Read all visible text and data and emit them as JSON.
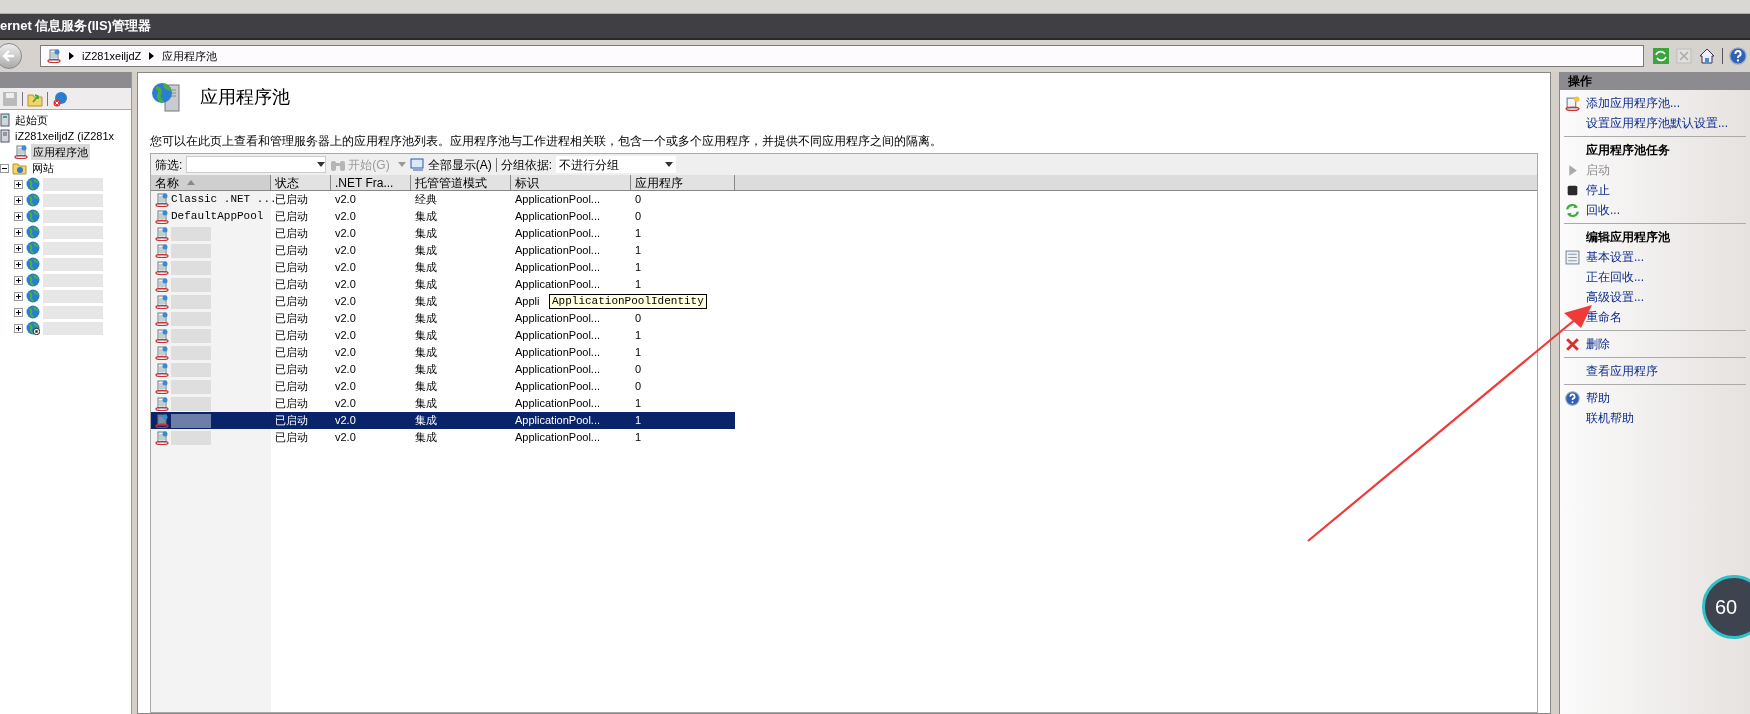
{
  "window": {
    "title": "ernet 信息服务(IIS)管理器"
  },
  "address_bar": {
    "breadcrumbs": [
      "iZ281xeiljdZ",
      "应用程序池"
    ]
  },
  "connections": {
    "tree": [
      {
        "label": "起始页",
        "kind": "page",
        "selected": false
      },
      {
        "label": "iZ281xeiljdZ (iZ281x",
        "kind": "server",
        "selected": false,
        "children": [
          {
            "label": "应用程序池",
            "kind": "pools",
            "selected": true
          },
          {
            "label": "网站",
            "kind": "sites",
            "selected": false,
            "expanded": true,
            "children": [
              {
                "kind": "site",
                "redacted": true,
                "stopped": false,
                "expanded": false,
                "selected": false
              },
              {
                "kind": "site",
                "redacted": true,
                "stopped": false,
                "expanded": false,
                "selected": false
              },
              {
                "kind": "site",
                "redacted": true,
                "stopped": false,
                "expanded": false,
                "selected": false
              },
              {
                "kind": "site",
                "redacted": true,
                "stopped": false,
                "expanded": false,
                "selected": false
              },
              {
                "kind": "site",
                "redacted": true,
                "stopped": false,
                "expanded": false,
                "selected": false
              },
              {
                "kind": "site",
                "redacted": true,
                "stopped": false,
                "expanded": false,
                "selected": false
              },
              {
                "kind": "site",
                "redacted": true,
                "stopped": false,
                "expanded": false,
                "selected": false
              },
              {
                "kind": "site",
                "redacted": true,
                "stopped": false,
                "expanded": false,
                "selected": false
              },
              {
                "kind": "site",
                "redacted": true,
                "stopped": false,
                "expanded": false,
                "selected": false
              },
              {
                "kind": "site",
                "redacted": true,
                "stopped": true,
                "expanded": false,
                "selected": false
              }
            ]
          }
        ]
      }
    ]
  },
  "page": {
    "title": "应用程序池",
    "description": "您可以在此页上查看和管理服务器上的应用程序池列表。应用程序池与工作进程相关联，包含一个或多个应用程序，并提供不同应用程序之间的隔离。"
  },
  "filter_bar": {
    "filter_label": "筛选:",
    "buttons": [
      {
        "label": "开始(G)",
        "kind": "start",
        "disabled": true
      },
      {
        "label": "全部显示(A)",
        "kind": "show-all",
        "disabled": false
      }
    ],
    "group_label": "分组依据:",
    "group_value": "不进行分组"
  },
  "table": {
    "columns": [
      {
        "label": "名称",
        "sorted": true
      },
      {
        "label": "状态",
        "sorted": false
      },
      {
        "label": ".NET Fra...",
        "sorted": false
      },
      {
        "label": "托管管道模式",
        "sorted": false
      },
      {
        "label": "标识",
        "sorted": false
      },
      {
        "label": "应用程序",
        "sorted": false
      }
    ],
    "rows": [
      {
        "name": "Classic .NET ...",
        "redacted": false,
        "status": "已启动",
        "framework": "v2.0",
        "pipeline": "经典",
        "identity": "ApplicationPool...",
        "applications": "0",
        "selected": false
      },
      {
        "name": "DefaultAppPool",
        "redacted": false,
        "status": "已启动",
        "framework": "v2.0",
        "pipeline": "集成",
        "identity": "ApplicationPool...",
        "applications": "0",
        "selected": false
      },
      {
        "redacted": true,
        "status": "已启动",
        "framework": "v2.0",
        "pipeline": "集成",
        "identity": "ApplicationPool...",
        "applications": "1",
        "selected": false
      },
      {
        "redacted": true,
        "status": "已启动",
        "framework": "v2.0",
        "pipeline": "集成",
        "identity": "ApplicationPool...",
        "applications": "1",
        "selected": false
      },
      {
        "redacted": true,
        "status": "已启动",
        "framework": "v2.0",
        "pipeline": "集成",
        "identity": "ApplicationPool...",
        "applications": "1",
        "selected": false
      },
      {
        "redacted": true,
        "status": "已启动",
        "framework": "v2.0",
        "pipeline": "集成",
        "identity": "ApplicationPool...",
        "applications": "1",
        "selected": false
      },
      {
        "redacted": true,
        "status": "已启动",
        "framework": "v2.0",
        "pipeline": "集成",
        "identity": "Appli",
        "selected": false
      },
      {
        "redacted": true,
        "status": "已启动",
        "framework": "v2.0",
        "pipeline": "集成",
        "identity": "ApplicationPool...",
        "applications": "0",
        "selected": false
      },
      {
        "redacted": true,
        "status": "已启动",
        "framework": "v2.0",
        "pipeline": "集成",
        "identity": "ApplicationPool...",
        "applications": "1",
        "selected": false
      },
      {
        "redacted": true,
        "status": "已启动",
        "framework": "v2.0",
        "pipeline": "集成",
        "identity": "ApplicationPool...",
        "applications": "1",
        "selected": false
      },
      {
        "redacted": true,
        "status": "已启动",
        "framework": "v2.0",
        "pipeline": "集成",
        "identity": "ApplicationPool...",
        "applications": "0",
        "selected": false
      },
      {
        "redacted": true,
        "status": "已启动",
        "framework": "v2.0",
        "pipeline": "集成",
        "identity": "ApplicationPool...",
        "applications": "0",
        "selected": false
      },
      {
        "redacted": true,
        "status": "已启动",
        "framework": "v2.0",
        "pipeline": "集成",
        "identity": "ApplicationPool...",
        "applications": "1",
        "selected": false
      },
      {
        "redacted": true,
        "status": "已启动",
        "framework": "v2.0",
        "pipeline": "集成",
        "identity": "ApplicationPool...",
        "applications": "1",
        "selected": true
      },
      {
        "redacted": true,
        "status": "已启动",
        "framework": "v2.0",
        "pipeline": "集成",
        "identity": "ApplicationPool...",
        "applications": "1",
        "selected": false
      }
    ]
  },
  "tooltip": {
    "text": "ApplicationPoolIdentity"
  },
  "actions": {
    "title": "操作",
    "sections": [
      {
        "items": [
          {
            "label": "添加应用程序池...",
            "kind": "add",
            "disabled": false
          },
          {
            "label": "设置应用程序池默认设置...",
            "kind": "plain",
            "disabled": false
          }
        ]
      },
      {
        "heading": "应用程序池任务",
        "items": [
          {
            "label": "启动",
            "kind": "start",
            "disabled": true
          },
          {
            "label": "停止",
            "kind": "stop",
            "disabled": false
          },
          {
            "label": "回收...",
            "kind": "recycle",
            "disabled": false
          }
        ]
      },
      {
        "heading": "编辑应用程序池",
        "items": [
          {
            "label": "基本设置...",
            "kind": "basic-settings",
            "disabled": false
          },
          {
            "label": "正在回收...",
            "kind": "plain",
            "disabled": false
          },
          {
            "label": "高级设置...",
            "kind": "plain",
            "disabled": false
          },
          {
            "label": "重命名",
            "kind": "plain",
            "disabled": false
          }
        ]
      },
      {
        "items": [
          {
            "label": "删除",
            "kind": "delete",
            "disabled": false
          }
        ]
      },
      {
        "items": [
          {
            "label": "查看应用程序",
            "kind": "plain",
            "disabled": false
          }
        ]
      },
      {
        "items": [
          {
            "label": "帮助",
            "kind": "help",
            "disabled": false
          },
          {
            "label": "联机帮助",
            "kind": "plain",
            "disabled": false
          }
        ]
      }
    ]
  },
  "overlay_badge": {
    "text": "60"
  }
}
